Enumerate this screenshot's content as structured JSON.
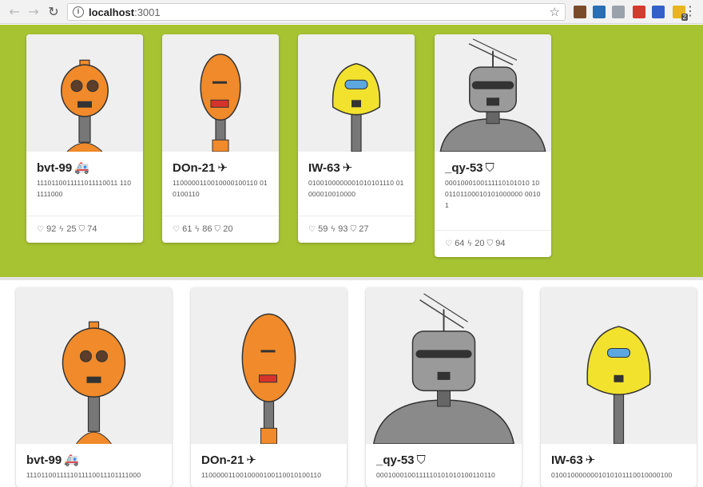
{
  "browser": {
    "url_host": "localhost",
    "url_port": ":3001",
    "ext_badge": "2"
  },
  "colors": {
    "green_band": "#a7c332",
    "robot_orange": "#f08a2a",
    "robot_yellow": "#f2e22e",
    "robot_gray": "#8a8a8a"
  },
  "top_robots": [
    {
      "name": "bvt-99",
      "mode_icon": "ambulance-icon",
      "mode_glyph": "🚑",
      "bits": "1110110011111011110011 1101111000",
      "health": "92",
      "speed": "25",
      "shield": "74",
      "style": "orange-round"
    },
    {
      "name": "DOn-21",
      "mode_icon": "airplane-icon",
      "mode_glyph": "✈",
      "bits": "1100000110010000100110 010100110",
      "health": "61",
      "speed": "86",
      "shield": "20",
      "style": "orange-oval"
    },
    {
      "name": "IW-63",
      "mode_icon": "airplane-icon",
      "mode_glyph": "✈",
      "bits": "0100100000001010101110 01000010010000",
      "health": "59",
      "speed": "93",
      "shield": "27",
      "style": "yellow"
    },
    {
      "name": "_qy-53",
      "mode_icon": "shield-icon",
      "mode_glyph": "⛉",
      "bits": "0001000100111110101010 1001101100010101000000 00101",
      "health": "64",
      "speed": "20",
      "shield": "94",
      "style": "gray"
    }
  ],
  "bottom_robots": [
    {
      "name": "bvt-99",
      "mode_icon": "ambulance-icon",
      "mode_glyph": "🚑",
      "bits": "1110110011111011110011101111000",
      "style": "orange-round"
    },
    {
      "name": "DOn-21",
      "mode_icon": "airplane-icon",
      "mode_glyph": "✈",
      "bits": "1100000110010000100110010100110",
      "style": "orange-oval"
    },
    {
      "name": "_qy-53",
      "mode_icon": "shield-icon",
      "mode_glyph": "⛉",
      "bits": "0001000100111110101010100110110",
      "style": "gray"
    },
    {
      "name": "IW-63",
      "mode_icon": "airplane-icon",
      "mode_glyph": "✈",
      "bits": "0100100000001010101110010000100",
      "style": "yellow"
    }
  ]
}
